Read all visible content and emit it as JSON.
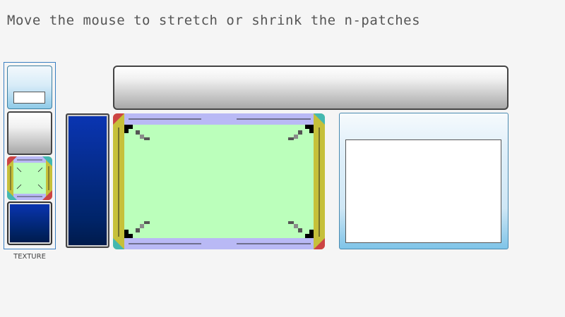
{
  "title": "Move the mouse to stretch or shrink the n-patches",
  "texture_panel": {
    "label": "TEXTURE",
    "tiles": [
      "frame-tile",
      "button-tile",
      "npatch-guide-tile",
      "blue-tile"
    ]
  },
  "colors": {
    "background": "#f5f5f5",
    "accent_border": "#3a7fc2",
    "npatch_center": "#bbffbb",
    "npatch_edge_horizontal": "#b9b9f5",
    "npatch_edge_vertical": "#c6c03a",
    "corner_red": "#cc4444",
    "corner_teal": "#44b8b0",
    "blue_patch": "#0a35b3"
  }
}
